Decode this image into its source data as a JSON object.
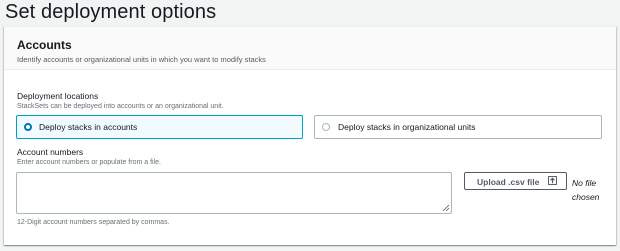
{
  "page": {
    "title": "Set deployment options"
  },
  "accounts_panel": {
    "heading": "Accounts",
    "description": "Identify accounts or organizational units in which you want to modify stacks"
  },
  "deployment_locations": {
    "label": "Deployment locations",
    "description": "StackSets can be deployed into accounts or an organizational unit.",
    "options": [
      {
        "label": "Deploy stacks in accounts",
        "selected": true
      },
      {
        "label": "Deploy stacks in organizational units",
        "selected": false
      }
    ]
  },
  "account_numbers": {
    "label": "Account numbers",
    "description": "Enter account numbers or populate from a file.",
    "value": "",
    "upload_label": "Upload .csv file",
    "file_status": "No file chosen",
    "constraint": "12-Digit account numbers separated by commas."
  },
  "colors": {
    "selected_border": "#00a1c9",
    "selected_bg": "#f1faff",
    "radio_selected": "#0073bb"
  }
}
